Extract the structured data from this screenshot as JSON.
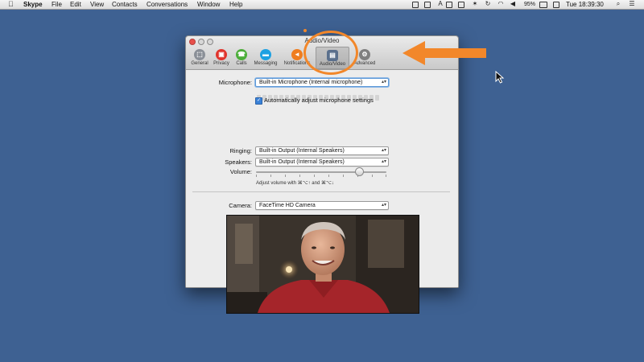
{
  "menubar": {
    "app_name": "Skype",
    "items": [
      "File",
      "Edit",
      "View",
      "Contacts",
      "Conversations",
      "Window",
      "Help"
    ],
    "battery": "95%",
    "clock": "Tue 18:39:30"
  },
  "window": {
    "title": "Audio/Video",
    "toolbar": [
      {
        "label": "General",
        "icon": "general-icon",
        "color": "#8a8f97"
      },
      {
        "label": "Privacy",
        "icon": "lock-icon",
        "color": "#e0342c"
      },
      {
        "label": "Calls",
        "icon": "phone-icon",
        "color": "#4cae3a"
      },
      {
        "label": "Messaging",
        "icon": "chat-icon",
        "color": "#1da1e2"
      },
      {
        "label": "Notifications",
        "icon": "megaphone-icon",
        "color": "#ef7d1f"
      },
      {
        "label": "Audio/Video",
        "icon": "video-icon",
        "color": "#5a6f8c"
      },
      {
        "label": "Advanced",
        "icon": "gear-icon",
        "color": "#7f7f7f"
      }
    ],
    "active_tab": "Audio/Video",
    "form": {
      "microphone_label": "Microphone:",
      "microphone_value": "Built-in Microphone (Internal microphone)",
      "auto_adjust_label": "Automatically adjust microphone settings",
      "auto_adjust_checked": true,
      "ringing_label": "Ringing:",
      "ringing_value": "Built-in Output (Internal Speakers)",
      "speakers_label": "Speakers:",
      "speakers_value": "Built-in Output (Internal Speakers)",
      "volume_label": "Volume:",
      "volume_level": 0.76,
      "volume_hint": "Adjust volume with ⌘⌥↑ and ⌘⌥↓",
      "camera_label": "Camera:",
      "camera_value": "FaceTime HD Camera"
    }
  },
  "colors": {
    "desktop": "#3e6192",
    "annotation": "#f2872a"
  }
}
